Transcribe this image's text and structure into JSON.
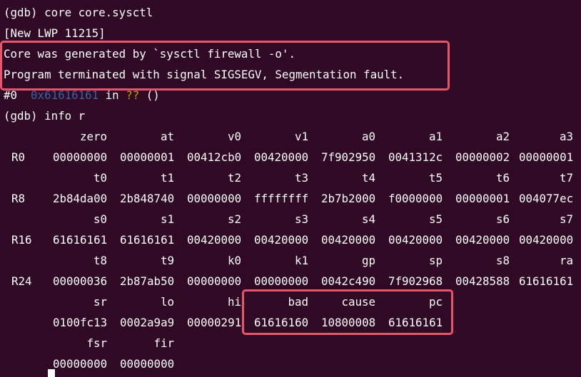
{
  "terminal": {
    "background": "#300a24",
    "foreground": "#ffffff",
    "highlight_color": "#e8546b",
    "lines": {
      "cmd_core": "(gdb) core core.sysctl",
      "new_lwp": "[New LWP 11215]",
      "core_generated": "Core was generated by `sysctl firewall -o'.",
      "program_terminated": "Program terminated with signal SIGSEGV, Segmentation fault.",
      "frame_prefix": "#0  ",
      "frame_addr": "0x61616161",
      "frame_in": " in ",
      "frame_fn": "??",
      "frame_suffix": " ()",
      "cmd_info": "(gdb) info r"
    },
    "register_rows": [
      {
        "label": "",
        "names": [
          "zero",
          "at",
          "v0",
          "v1",
          "a0",
          "a1",
          "a2",
          "a3"
        ]
      },
      {
        "label": "R0",
        "values": [
          "00000000",
          "00000001",
          "00412cb0",
          "00420000",
          "7f902950",
          "0041312c",
          "00000002",
          "00000001"
        ]
      },
      {
        "label": "",
        "names": [
          "t0",
          "t1",
          "t2",
          "t3",
          "t4",
          "t5",
          "t6",
          "t7"
        ]
      },
      {
        "label": "R8",
        "values": [
          "2b84da00",
          "2b848740",
          "00000000",
          "ffffffff",
          "2b7b2000",
          "f0000000",
          "00000001",
          "004077ec"
        ]
      },
      {
        "label": "",
        "names": [
          "s0",
          "s1",
          "s2",
          "s3",
          "s4",
          "s5",
          "s6",
          "s7"
        ]
      },
      {
        "label": "R16",
        "values": [
          "61616161",
          "61616161",
          "00420000",
          "00420000",
          "00420000",
          "00420000",
          "00420000",
          "00420000"
        ]
      },
      {
        "label": "",
        "names": [
          "t8",
          "t9",
          "k0",
          "k1",
          "gp",
          "sp",
          "s8",
          "ra"
        ]
      },
      {
        "label": "R24",
        "values": [
          "00000036",
          "2b87ab50",
          "00000000",
          "00000000",
          "0042c490",
          "7f902968",
          "00428588",
          "61616161"
        ]
      },
      {
        "label": "",
        "names": [
          "sr",
          "lo",
          "hi",
          "bad",
          "cause",
          "pc"
        ]
      },
      {
        "label": "",
        "values": [
          "0100fc13",
          "0002a9a9",
          "00000291",
          "61616160",
          "10800008",
          "61616161"
        ]
      },
      {
        "label": "",
        "names": [
          "fsr",
          "fir"
        ]
      },
      {
        "label": "",
        "values": [
          "00000000",
          "00000000"
        ]
      }
    ]
  }
}
